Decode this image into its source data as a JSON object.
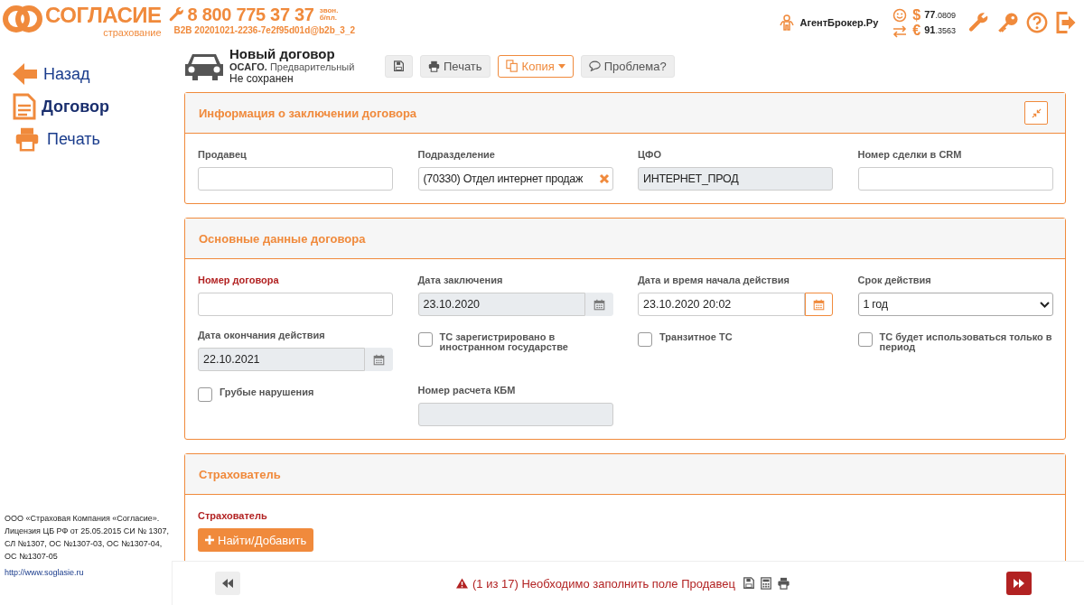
{
  "header": {
    "brand": "СОГЛАСИЕ",
    "brand_sub": "страхование",
    "phone": "8 800 775 37 37",
    "phone_note": [
      "звон.",
      "б/пл."
    ],
    "build": "B2B 20201021-2236-7e2f95d01d@b2b_3_2",
    "user": "АгентБрокер.Ру",
    "rates": [
      {
        "symbol": "$",
        "whole": "77",
        "fraction": ".0809"
      },
      {
        "symbol": "€",
        "whole": "91",
        "fraction": ".3563"
      }
    ]
  },
  "sidebar": {
    "items": [
      {
        "label": "Назад",
        "kind": "back",
        "selected": false
      },
      {
        "label": "Договор",
        "kind": "document",
        "selected": true
      },
      {
        "label": "Печать",
        "kind": "print",
        "selected": false
      }
    ],
    "footer": {
      "text": "ООО «Страховая Компания «Согласие». Лицензия ЦБ РФ от 25.05.2015 СИ № 1307, СЛ №1307, ОС №1307-03, ОС №1307-04, ОС №1307-05",
      "link": "http://www.soglasie.ru"
    }
  },
  "document": {
    "title": "Новый договор",
    "subtitle": "**ОСАГО.** Предварительный",
    "status": "Не сохранен",
    "toolbar": [
      {
        "kind": "save"
      },
      {
        "kind": "print",
        "label": "Печать"
      },
      {
        "kind": "copy",
        "label": "Копия"
      },
      {
        "kind": "problem",
        "label": "Проблема?"
      }
    ]
  },
  "panels": [
    {
      "title": "Информация о заключении договора",
      "collapsible": true,
      "fields": [
        {
          "kind": "text",
          "label": "Продавец",
          "required": false,
          "disabled": false
        },
        {
          "kind": "text",
          "label": "Подразделение",
          "required": false,
          "disabled": false,
          "value": "(70330) Отдел интернет продаж",
          "clearable": true
        },
        {
          "kind": "text",
          "label": "ЦФО",
          "required": false,
          "disabled": true,
          "value": "ИНТЕРНЕТ_ПРОД"
        },
        {
          "kind": "text",
          "label": "Номер сделки в CRM",
          "required": false,
          "disabled": false
        }
      ]
    },
    {
      "title": "Основные данные договора",
      "collapsible": false,
      "fields": [
        {
          "kind": "text",
          "label": "Номер договора",
          "required": true,
          "disabled": false
        },
        {
          "kind": "date",
          "label": "Дата заключения",
          "required": false,
          "disabled": true,
          "value": "23.10.2020"
        },
        {
          "kind": "date",
          "label": "Дата и время начала действия",
          "required": false,
          "disabled": false,
          "value": "23.10.2020 20:02"
        },
        {
          "kind": "select",
          "label": "Срок действия",
          "required": false,
          "disabled": false,
          "value": "1 год"
        },
        {
          "kind": "date",
          "label": "Дата окончания действия",
          "required": false,
          "disabled": true,
          "value": "22.10.2021"
        },
        {
          "kind": "checkbox",
          "label": "ТС зарегистрировано в иностранном государстве",
          "checked": false
        },
        {
          "kind": "checkbox",
          "label": "Транзитное ТС",
          "checked": false
        },
        {
          "kind": "checkbox",
          "label": "ТС будет использоваться только в период",
          "checked": false
        },
        {
          "kind": "checkbox",
          "label": "Грубые нарушения",
          "checked": false
        },
        {
          "kind": "text",
          "label": "Номер расчета КБМ",
          "required": false,
          "disabled": true
        }
      ]
    },
    {
      "title": "Страхователь",
      "collapsible": false,
      "fields": [
        {
          "kind": "action",
          "label": "Страхователь",
          "required": true,
          "button": "Найти/Добавить"
        }
      ]
    }
  ],
  "status_bar": {
    "message": "(1 из 17) Необходимо заполнить поле Продавец"
  }
}
